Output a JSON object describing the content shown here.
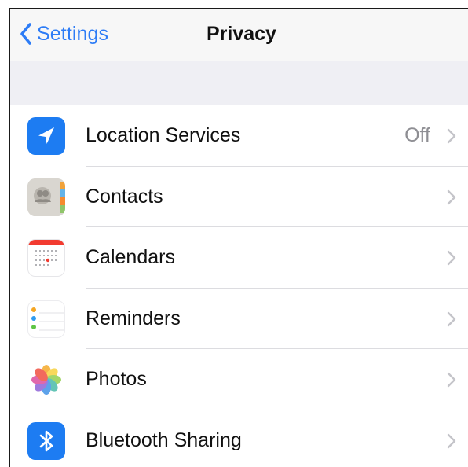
{
  "navbar": {
    "back_label": "Settings",
    "title": "Privacy"
  },
  "rows": [
    {
      "label": "Location Services",
      "detail": "Off",
      "icon": "location-arrow-icon"
    },
    {
      "label": "Contacts",
      "detail": "",
      "icon": "contacts-icon"
    },
    {
      "label": "Calendars",
      "detail": "",
      "icon": "calendar-icon"
    },
    {
      "label": "Reminders",
      "detail": "",
      "icon": "reminders-icon"
    },
    {
      "label": "Photos",
      "detail": "",
      "icon": "photos-icon"
    },
    {
      "label": "Bluetooth Sharing",
      "detail": "",
      "icon": "bluetooth-icon"
    }
  ],
  "colors": {
    "accent": "#2d7cf6",
    "grouped_background": "#efeff4",
    "location_icon_bg": "#1d7cf2",
    "bluetooth_icon_bg": "#1d7cf2",
    "calendar_red": "#f23b30"
  }
}
